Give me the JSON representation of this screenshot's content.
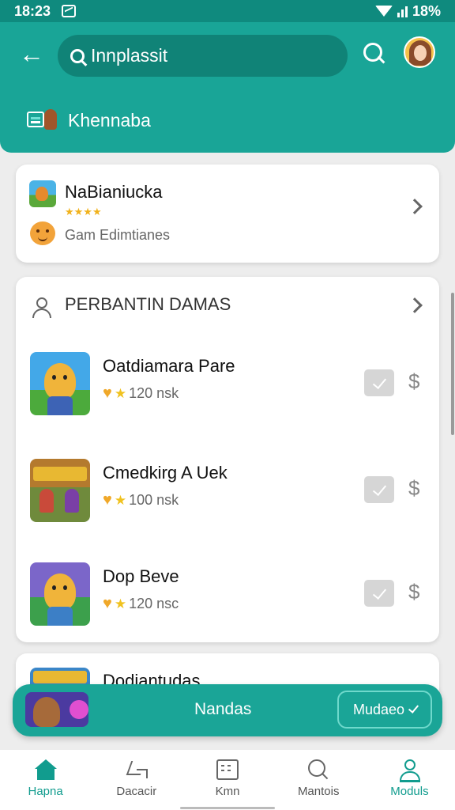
{
  "status_bar": {
    "time": "18:23",
    "battery": "18%"
  },
  "header": {
    "search_value": "Innplassit",
    "subtitle": "Khennaba"
  },
  "featured_card": {
    "title": "NaBianiucka",
    "rating_stars": 4,
    "subtitle": "Gam Edimtianes"
  },
  "list_section": {
    "title": "PERBANTIN DAMAS",
    "items": [
      {
        "title": "Oatdiamara Pare",
        "meta": "120 nsk",
        "price_icon": "$"
      },
      {
        "title": "Cmedkirg A Uek",
        "meta": "100 nsk",
        "price_icon": "$"
      },
      {
        "title": "Dop Beve",
        "meta": "120 nsc",
        "price_icon": "$"
      }
    ]
  },
  "partial_card": {
    "title": "Dodiantudas"
  },
  "mini_player": {
    "title": "Nandas",
    "button_label": "Mudaeo"
  },
  "bottom_nav": [
    {
      "label": "Hapna",
      "icon": "home-icon",
      "active": true
    },
    {
      "label": "Dacacir",
      "icon": "discover-icon",
      "active": false
    },
    {
      "label": "Kmn",
      "icon": "grid-icon",
      "active": false
    },
    {
      "label": "Mantois",
      "icon": "search-icon",
      "active": false
    },
    {
      "label": "Moduls",
      "icon": "user-icon",
      "active": true
    }
  ],
  "colors": {
    "primary": "#19a597",
    "primary_dark": "#108377",
    "accent_text": "#119c8e"
  }
}
